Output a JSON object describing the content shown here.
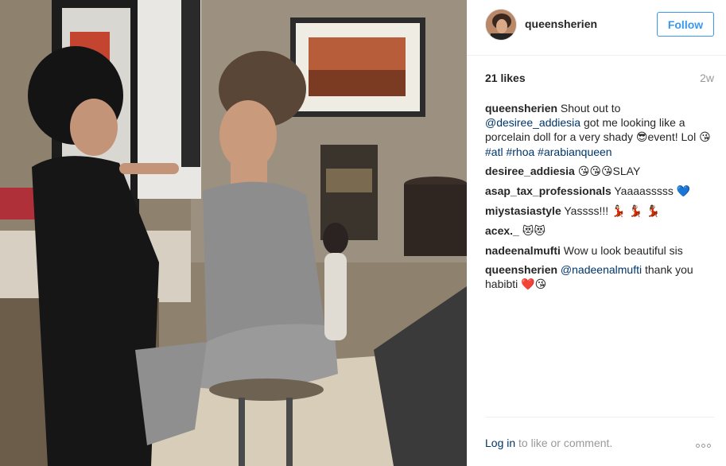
{
  "post": {
    "username": "queensherien",
    "follow_label": "Follow",
    "likes": "21 likes",
    "time": "2w"
  },
  "comments": [
    {
      "user": "queensherien",
      "parts": [
        {
          "t": "text",
          "v": " Shout out to "
        },
        {
          "t": "mention",
          "v": "@desiree_addiesia"
        },
        {
          "t": "text",
          "v": " got me looking like a porcelain doll for a very shady "
        },
        {
          "t": "emoji",
          "v": "😎"
        },
        {
          "t": "text",
          "v": "event! Lol "
        },
        {
          "t": "emoji",
          "v": "😘"
        },
        {
          "t": "mention",
          "v": "#atl"
        },
        {
          "t": "text",
          "v": " "
        },
        {
          "t": "mention",
          "v": "#rhoa"
        },
        {
          "t": "text",
          "v": " "
        },
        {
          "t": "mention",
          "v": "#arabianqueen"
        }
      ]
    },
    {
      "user": "desiree_addiesia",
      "parts": [
        {
          "t": "text",
          "v": " "
        },
        {
          "t": "emoji",
          "v": "😘😘😘"
        },
        {
          "t": "text",
          "v": "SLAY"
        }
      ]
    },
    {
      "user": "asap_tax_professionals",
      "parts": [
        {
          "t": "text",
          "v": " Yaaaasssss "
        },
        {
          "t": "emoji",
          "v": "💙"
        }
      ]
    },
    {
      "user": "miystasiastyle",
      "parts": [
        {
          "t": "text",
          "v": " Yassss!!! "
        },
        {
          "t": "emoji",
          "v": "💃🏻 💃🏽 💃🏾"
        }
      ]
    },
    {
      "user": "acex._",
      "parts": [
        {
          "t": "text",
          "v": " "
        },
        {
          "t": "emoji",
          "v": "😻😻"
        }
      ]
    },
    {
      "user": "nadeenalmufti",
      "parts": [
        {
          "t": "text",
          "v": " Wow u look beautiful sis"
        }
      ]
    },
    {
      "user": "queensherien",
      "parts": [
        {
          "t": "text",
          "v": " "
        },
        {
          "t": "mention",
          "v": "@nadeenalmufti"
        },
        {
          "t": "text",
          "v": " thank you habibti "
        },
        {
          "t": "emoji",
          "v": "❤️😘"
        }
      ]
    }
  ],
  "footer": {
    "login_label": "Log in",
    "login_suffix": " to like or comment."
  },
  "icons": {
    "more": "more-options-icon"
  },
  "colors": {
    "follow_blue": "#3897f0",
    "link_blue": "#003569",
    "muted_gray": "#999999"
  }
}
